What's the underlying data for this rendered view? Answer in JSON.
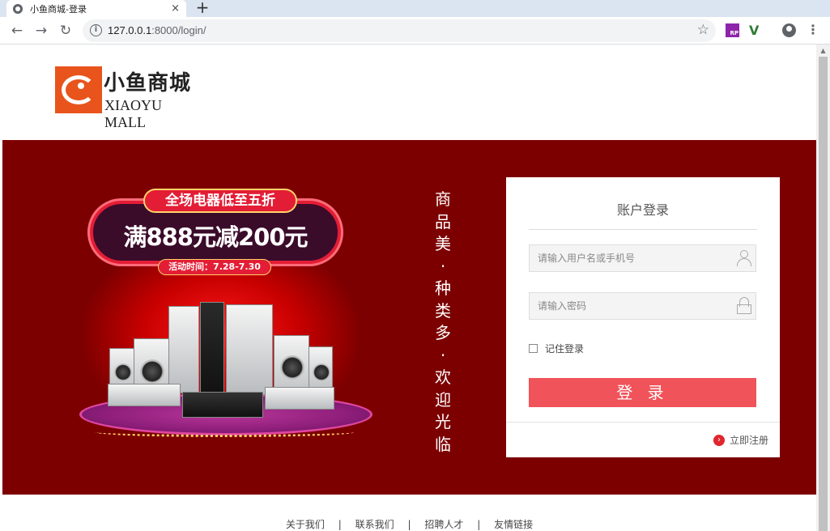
{
  "browser": {
    "tab_title": "小鱼商城-登录",
    "tab_close": "×",
    "new_tab": "+",
    "url_host": "127.0.0.1",
    "url_path": ":8000/login/",
    "info_icon": "i",
    "extension_rp": "RP"
  },
  "logo": {
    "name_cn": "小鱼商城",
    "name_en": "XIAOYU MALL"
  },
  "promo": {
    "headline": "全场电器低至五折",
    "offer": "满888元减200元",
    "date": "活动时间：7.28-7.30"
  },
  "slogan": [
    "商",
    "品",
    "美",
    "·",
    "种",
    "类",
    "多",
    "·",
    "欢",
    "迎",
    "光",
    "临"
  ],
  "login": {
    "title": "账户登录",
    "username_placeholder": "请输入用户名或手机号",
    "password_placeholder": "请输入密码",
    "remember_label": "记住登录",
    "submit_label": "登 录",
    "register_label": "立即注册",
    "register_arrow": "›"
  },
  "footer": {
    "links": [
      "关于我们",
      "联系我们",
      "招聘人才",
      "友情链接"
    ],
    "separator": "|"
  },
  "colors": {
    "banner_bg": "#7d0000",
    "login_button": "#f05359",
    "logo_orange": "#e8541b"
  }
}
